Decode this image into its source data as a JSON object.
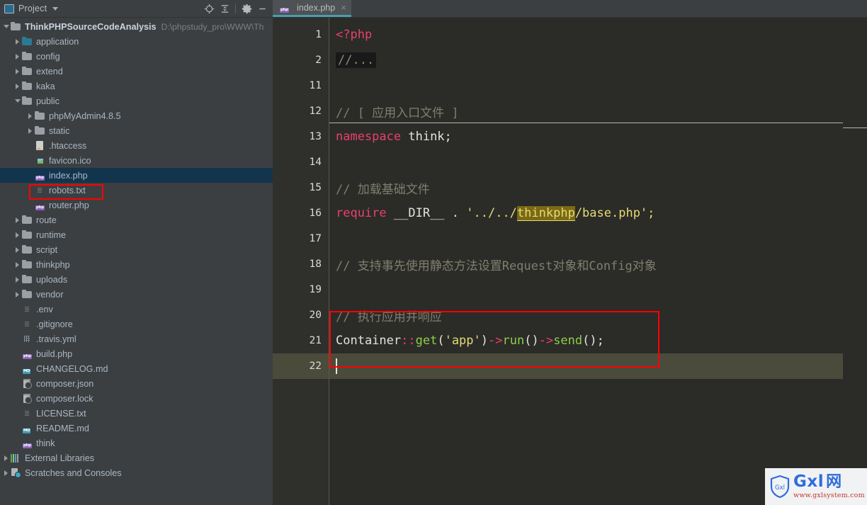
{
  "window": {
    "tool_window_title": "Project",
    "toolbar_icons": [
      "locate-icon",
      "collapse-all-icon",
      "settings-gear-icon",
      "minimize-icon"
    ]
  },
  "tabs": [
    {
      "label": "index.php",
      "icon": "php-file-icon",
      "close": "×",
      "active": true
    }
  ],
  "sidebar": {
    "tree": [
      {
        "indent": 0,
        "arrow": "open",
        "icon": "folder-icon",
        "label": "ThinkPHPSourceCodeAnalysis",
        "path": "D:\\phpstudy_pro\\WWW\\Th",
        "bold": true
      },
      {
        "indent": 1,
        "arrow": "closed",
        "icon": "folder-source-icon",
        "label": "application"
      },
      {
        "indent": 1,
        "arrow": "closed",
        "icon": "folder-icon",
        "label": "config"
      },
      {
        "indent": 1,
        "arrow": "closed",
        "icon": "folder-icon",
        "label": "extend"
      },
      {
        "indent": 1,
        "arrow": "closed",
        "icon": "folder-icon",
        "label": "kaka"
      },
      {
        "indent": 1,
        "arrow": "open",
        "icon": "folder-icon",
        "label": "public"
      },
      {
        "indent": 2,
        "arrow": "closed",
        "icon": "folder-icon",
        "label": "phpMyAdmin4.8.5"
      },
      {
        "indent": 2,
        "arrow": "closed",
        "icon": "folder-icon",
        "label": "static"
      },
      {
        "indent": 2,
        "arrow": "none",
        "icon": "htaccess-file-icon",
        "label": ".htaccess"
      },
      {
        "indent": 2,
        "arrow": "none",
        "icon": "ico-file-icon",
        "label": "favicon.ico"
      },
      {
        "indent": 2,
        "arrow": "none",
        "icon": "php-file-icon",
        "label": "index.php",
        "selected": true,
        "highlighted": true
      },
      {
        "indent": 2,
        "arrow": "none",
        "icon": "text-file-icon",
        "label": "robots.txt"
      },
      {
        "indent": 2,
        "arrow": "none",
        "icon": "php-file-icon",
        "label": "router.php"
      },
      {
        "indent": 1,
        "arrow": "closed",
        "icon": "folder-icon",
        "label": "route"
      },
      {
        "indent": 1,
        "arrow": "closed",
        "icon": "folder-icon",
        "label": "runtime"
      },
      {
        "indent": 1,
        "arrow": "closed",
        "icon": "folder-icon",
        "label": "script"
      },
      {
        "indent": 1,
        "arrow": "closed",
        "icon": "folder-icon",
        "label": "thinkphp"
      },
      {
        "indent": 1,
        "arrow": "closed",
        "icon": "folder-icon",
        "label": "uploads"
      },
      {
        "indent": 1,
        "arrow": "closed",
        "icon": "folder-icon",
        "label": "vendor"
      },
      {
        "indent": 1,
        "arrow": "none",
        "icon": "text-file-icon",
        "label": ".env"
      },
      {
        "indent": 1,
        "arrow": "none",
        "icon": "text-file-icon",
        "label": ".gitignore"
      },
      {
        "indent": 1,
        "arrow": "none",
        "icon": "yaml-file-icon",
        "label": ".travis.yml"
      },
      {
        "indent": 1,
        "arrow": "none",
        "icon": "php-file-icon",
        "label": "build.php"
      },
      {
        "indent": 1,
        "arrow": "none",
        "icon": "markdown-file-icon",
        "label": "CHANGELOG.md"
      },
      {
        "indent": 1,
        "arrow": "none",
        "icon": "json-file-icon",
        "label": "composer.json"
      },
      {
        "indent": 1,
        "arrow": "none",
        "icon": "json-file-icon",
        "label": "composer.lock"
      },
      {
        "indent": 1,
        "arrow": "none",
        "icon": "text-file-icon",
        "label": "LICENSE.txt"
      },
      {
        "indent": 1,
        "arrow": "none",
        "icon": "markdown-file-icon",
        "label": "README.md"
      },
      {
        "indent": 1,
        "arrow": "none",
        "icon": "php-file-icon",
        "label": "think"
      },
      {
        "indent": 0,
        "arrow": "closed",
        "icon": "external-libraries-icon",
        "label": "External Libraries"
      },
      {
        "indent": 0,
        "arrow": "closed",
        "icon": "scratches-icon",
        "label": "Scratches and Consoles"
      }
    ]
  },
  "editor": {
    "line_numbers": [
      "1",
      "2",
      "11",
      "12",
      "13",
      "14",
      "15",
      "16",
      "17",
      "18",
      "19",
      "20",
      "21",
      "22"
    ],
    "fold_marker": "+",
    "caret_line_number": "22",
    "lines": [
      {
        "n": "1",
        "tokens": [
          {
            "t": "<?php",
            "c": "kw"
          }
        ]
      },
      {
        "n": "2",
        "tokens": [
          {
            "t": "//...",
            "c": "fold"
          }
        ],
        "folded": true
      },
      {
        "n": "11",
        "tokens": []
      },
      {
        "n": "12",
        "tokens": [
          {
            "t": "// [ 应用入口文件 ]",
            "c": "cmt"
          }
        ],
        "separator_below": true
      },
      {
        "n": "13",
        "tokens": [
          {
            "t": "namespace",
            "c": "kw"
          },
          {
            "t": " think;",
            "c": "wht"
          }
        ]
      },
      {
        "n": "14",
        "tokens": []
      },
      {
        "n": "15",
        "tokens": [
          {
            "t": "// 加载基础文件",
            "c": "cmt"
          }
        ]
      },
      {
        "n": "16",
        "tokens": [
          {
            "t": "require",
            "c": "kw"
          },
          {
            "t": " __DIR__ ",
            "c": "wht"
          },
          {
            "t": ". ",
            "c": "wht"
          },
          {
            "t": "'../../",
            "c": "str"
          },
          {
            "t": "thinkphp",
            "c": "hl-ident"
          },
          {
            "t": "/base.php';",
            "c": "str"
          }
        ]
      },
      {
        "n": "17",
        "tokens": []
      },
      {
        "n": "18",
        "tokens": [
          {
            "t": "// 支持事先使用静态方法设置Request对象和Config对象",
            "c": "cmt"
          }
        ]
      },
      {
        "n": "19",
        "tokens": []
      },
      {
        "n": "20",
        "tokens": [
          {
            "t": "// 执行应用并响应",
            "c": "cmt"
          }
        ]
      },
      {
        "n": "21",
        "tokens": [
          {
            "t": "Container",
            "c": "wht"
          },
          {
            "t": "::",
            "c": "kw"
          },
          {
            "t": "get",
            "c": "grn"
          },
          {
            "t": "(",
            "c": "wht"
          },
          {
            "t": "'app'",
            "c": "str"
          },
          {
            "t": ")",
            "c": "wht"
          },
          {
            "t": "->",
            "c": "kw"
          },
          {
            "t": "run",
            "c": "grn"
          },
          {
            "t": "()",
            "c": "wht"
          },
          {
            "t": "->",
            "c": "kw"
          },
          {
            "t": "send",
            "c": "grn"
          },
          {
            "t": "();",
            "c": "wht"
          }
        ]
      },
      {
        "n": "22",
        "tokens": [],
        "caret": true
      }
    ]
  },
  "annotations": {
    "highlight_color": "#ff0000",
    "boxes": [
      {
        "name": "index-php-file-highlight"
      },
      {
        "name": "run-application-code-highlight"
      }
    ]
  },
  "watermark": {
    "shield_text": "Gxl",
    "brand": "Gxl",
    "brand_cn": "网",
    "url": "www.gxlsystem.com"
  }
}
